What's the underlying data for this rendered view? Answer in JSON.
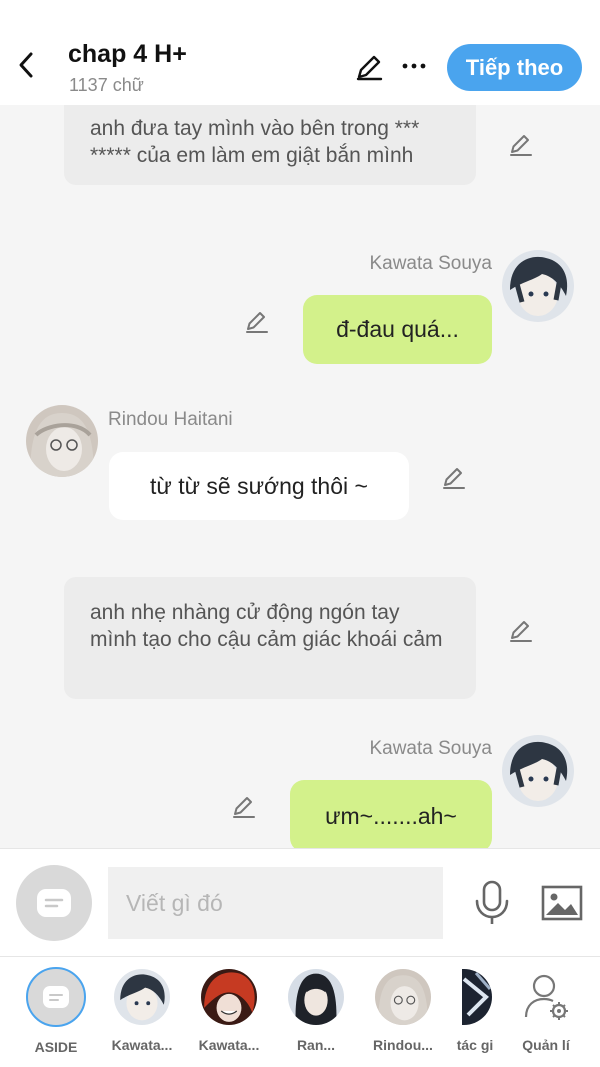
{
  "header": {
    "title": "chap 4 H+",
    "word_count": "1137 chữ",
    "next_label": "Tiếp theo"
  },
  "messages": [
    {
      "type": "narration",
      "text": "anh đưa tay mình vào bên trong *** ***** của em làm em giật bắn mình"
    },
    {
      "type": "right",
      "speaker": "Kawata Souya",
      "text": "đ-đau quá..."
    },
    {
      "type": "left",
      "speaker": "Rindou Haitani",
      "text": "từ từ sẽ sướng thôi ~"
    },
    {
      "type": "narration",
      "text": "anh nhẹ nhàng cử động ngón tay mình tạo cho cậu cảm giác khoái cảm"
    },
    {
      "type": "right",
      "speaker": "Kawata Souya",
      "text": "ưm~.......ah~"
    }
  ],
  "composer": {
    "placeholder": "Viết gì đó"
  },
  "characters": [
    {
      "label": "ASIDE"
    },
    {
      "label": "Kawata..."
    },
    {
      "label": "Kawata..."
    },
    {
      "label": "Ran..."
    },
    {
      "label": "Rindou..."
    },
    {
      "label": "tác gi"
    },
    {
      "label": "Quản lí"
    }
  ],
  "colors": {
    "accent": "#4aa4ee",
    "bubble_right": "#d3f18b",
    "bubble_left": "#ffffff",
    "narration_bg": "#ececec",
    "background": "#f5f5f5"
  },
  "icons": [
    "back-icon",
    "pencil-icon",
    "more-icon",
    "message-icon",
    "mic-icon",
    "image-icon",
    "user-settings-icon"
  ]
}
